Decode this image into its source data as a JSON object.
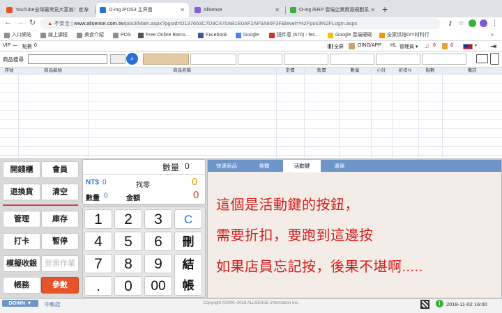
{
  "browser": {
    "tabs": [
      {
        "title": "YouTube全球最常見大富翁！官方",
        "color": "#e8542a"
      },
      {
        "title": "O-ing /POS3 主界面",
        "color": "#2a6ed6"
      },
      {
        "title": "Allsense",
        "color": "#8a5cd6"
      },
      {
        "title": "O-ing /ERP 雲端企業資源規劃系",
        "color": "#3cae3c"
      }
    ],
    "new_tab": "+",
    "nav": {
      "back": "←",
      "forward": "→",
      "reload": "↻"
    },
    "address": {
      "warning": "▲",
      "not_secure": "不安全",
      "host": "www.allsense.com.tw",
      "path": "/pos3/Main.aspx?pguid=D137653C7D9C470AB1E0AF2AF5A90F3F&level=%2Fpos3%2FLogin.aspx"
    },
    "bookmarks": [
      {
        "label": "入口網站",
        "color": "#8d8d8d"
      },
      {
        "label": "線上課程",
        "color": "#8d8d8d"
      },
      {
        "label": "美食介紹",
        "color": "#8d8d8d"
      },
      {
        "label": "POS",
        "color": "#8d8d8d"
      },
      {
        "label": "Free Online Barco...",
        "color": "#555555"
      },
      {
        "label": "Facebook",
        "color": "#3b5998"
      },
      {
        "label": "Google",
        "color": "#4285f4"
      },
      {
        "label": "锐件意 (670) - fec...",
        "color": "#d93025"
      },
      {
        "label": "Google 雲端硬碟",
        "color": "#fbbc04"
      },
      {
        "label": "全家烘焙DIY材料行",
        "color": "#f29900"
      }
    ],
    "overflow": "»"
  },
  "header": {
    "vip_label": "VIP",
    "vip_value": "—",
    "points_label": "點數",
    "points_value": "0",
    "fullscreen": "全屏",
    "app": "OING/APP",
    "hl": "HL",
    "manager": "管理員 ▾",
    "counter_a": "0",
    "counter_b": "0"
  },
  "search": {
    "label": "商品搜尋",
    "placeholder": ""
  },
  "table": {
    "columns": [
      "序號",
      "商品編號",
      "商品名稱",
      "定價",
      "售價",
      "數量",
      "小計",
      "折扣%",
      "點數",
      "備註"
    ]
  },
  "function_buttons": [
    "開錢櫃",
    "會員",
    "退換貨",
    "清空",
    "管理",
    "庫存",
    "打卡",
    "暫停",
    "模擬收銀",
    "登票作業",
    "帳務",
    "參數"
  ],
  "display": {
    "qty_label": "數量",
    "qty_value": "0",
    "ntd_label": "NT$",
    "ntd_value": "0",
    "change_label": "找零",
    "change_value": "0",
    "count_label": "數量",
    "count_value": "0",
    "amount_label": "金額",
    "amount_value": "0"
  },
  "keypad": [
    "1",
    "2",
    "3",
    "C",
    "4",
    "5",
    "6",
    "刪",
    "7",
    "8",
    "9",
    "結",
    ".",
    "0",
    "00",
    "帳"
  ],
  "right_panel": {
    "tabs": [
      "快速商品",
      "券類",
      "活動鍵",
      "選單"
    ],
    "active_tab": 2,
    "annotation": [
      "這個是活動鍵的按鈕，",
      "需要折扣，要跑到這邊按",
      "如果店員忘記按，後果不堪啊....."
    ]
  },
  "status": {
    "down": "DOWN ▼",
    "store": "中和店",
    "copyright": "Copyright ©2000~2018 ALLSENSE Information Inc.",
    "info": "i",
    "datetime": "2018-11-02 16:00"
  },
  "colors": {
    "accent_blue": "#6d95c8",
    "orange_button": "#e8542a",
    "annotation_red": "#d41d1d",
    "amount_orange": "#f29900",
    "amount_red": "#d43b3b"
  }
}
